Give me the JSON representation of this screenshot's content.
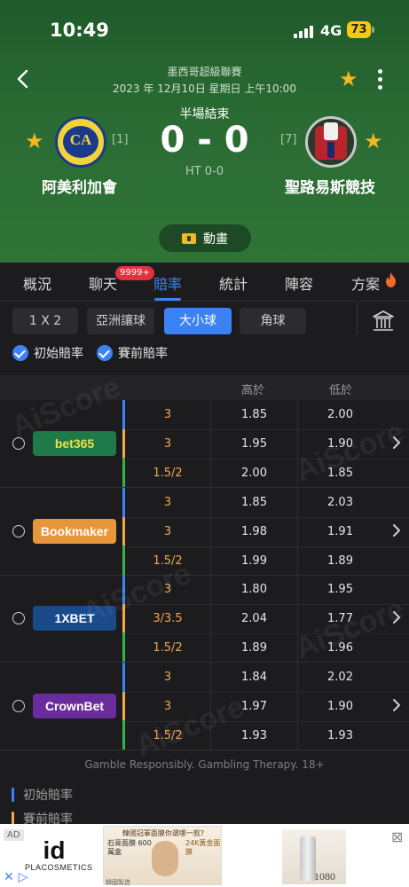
{
  "status_bar": {
    "time": "10:49",
    "network": "4G",
    "battery": "73"
  },
  "match": {
    "league": "墨西哥超級聯賽",
    "datetime": "2023 年 12月10日 星期日 上午10:00",
    "status": "半場結束",
    "score": "0 - 0",
    "halftime": "HT 0-0",
    "home": {
      "name": "阿美利加會",
      "rank": "[1]",
      "logo_text": "CA"
    },
    "away": {
      "name": "聖路易斯競技",
      "rank": "[7]"
    },
    "animation_label": "動畫"
  },
  "tabs": [
    {
      "label": "概況"
    },
    {
      "label": "聊天",
      "badge": "9999+"
    },
    {
      "label": "賠率",
      "active": true
    },
    {
      "label": "統計"
    },
    {
      "label": "陣容"
    },
    {
      "label": "方案"
    }
  ],
  "odds_types": [
    {
      "label": "1 X 2"
    },
    {
      "label": "亞洲讓球"
    },
    {
      "label": "大小球",
      "active": true
    },
    {
      "label": "角球"
    }
  ],
  "filters": {
    "initial": "初始賠率",
    "pre_match": "賽前賠率"
  },
  "table_header": {
    "over": "高於",
    "under": "低於"
  },
  "bookmakers": [
    {
      "name": "bet365",
      "color": "#1f7a4a",
      "text_color": "#f0e04a",
      "rows": [
        {
          "h": "3",
          "o": "1.85",
          "u": "2.00"
        },
        {
          "h": "3",
          "o": "1.95",
          "u": "1.90"
        },
        {
          "h": "1.5/2",
          "o": "2.00",
          "u": "1.85"
        }
      ]
    },
    {
      "name": "Bookmaker",
      "color": "#e8963a",
      "text_color": "#ffffff",
      "rows": [
        {
          "h": "3",
          "o": "1.85",
          "u": "2.03"
        },
        {
          "h": "3",
          "o": "1.98",
          "u": "1.91"
        },
        {
          "h": "1.5/2",
          "o": "1.99",
          "u": "1.89"
        }
      ]
    },
    {
      "name": "1XBET",
      "color": "#1a4a8a",
      "text_color": "#ffffff",
      "rows": [
        {
          "h": "3",
          "o": "1.80",
          "u": "1.95"
        },
        {
          "h": "3/3.5",
          "o": "2.04",
          "u": "1.77"
        },
        {
          "h": "1.5/2",
          "o": "1.89",
          "u": "1.96"
        }
      ]
    },
    {
      "name": "CrownBet",
      "color": "#6a2c9a",
      "text_color": "#ffffff",
      "rows": [
        {
          "h": "3",
          "o": "1.84",
          "u": "2.02"
        },
        {
          "h": "3",
          "o": "1.97",
          "u": "1.90"
        },
        {
          "h": "1.5/2",
          "o": "1.93",
          "u": "1.93"
        }
      ]
    }
  ],
  "watermark": "AiScore",
  "gamble_note": "Gamble Responsibly. Gambling Therapy. 18+",
  "legend": {
    "initial": "初始賠率",
    "pre_match": "賽前賠率"
  },
  "ad": {
    "label": "AD",
    "brand_mark": "id",
    "brand_name": "PLACOSMETICS",
    "banner_head": "韓國冠軍面膜你選哪一款?",
    "banner_left": "石膏面膜 600萬盒",
    "banner_right": "24K黃金面膜",
    "banner_foot": "韓國製造",
    "product_num": "1080"
  },
  "colors": {
    "accent": "#3b82f6",
    "initial_line": "#3b82f6",
    "pre_match_line": "#f0a64a",
    "live_line": "#35b34a",
    "star": "#f2b922"
  }
}
